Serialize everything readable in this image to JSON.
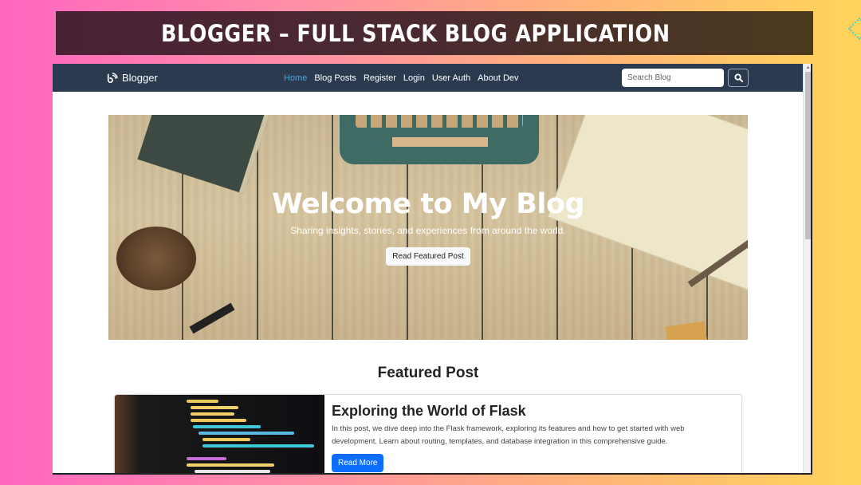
{
  "banner": {
    "title": "BLOGGER – FULL STACK BLOG APPLICATION"
  },
  "navbar": {
    "brand": "Blogger",
    "brand_icon": "feed-icon",
    "links": [
      {
        "label": "Home",
        "active": true
      },
      {
        "label": "Blog Posts",
        "active": false
      },
      {
        "label": "Register",
        "active": false
      },
      {
        "label": "Login",
        "active": false
      },
      {
        "label": "User Auth",
        "active": false
      },
      {
        "label": "About Dev",
        "active": false
      }
    ],
    "search": {
      "placeholder": "Search Blog",
      "value": "",
      "button_icon": "search-icon"
    }
  },
  "hero": {
    "title": "Welcome to My Blog",
    "subtitle": "Sharing insights, stories, and experiences from around the world.",
    "button_label": "Read Featured Post"
  },
  "featured": {
    "heading": "Featured Post",
    "post": {
      "title": "Exploring the World of Flask",
      "excerpt": "In this post, we dive deep into the Flask framework, exploring its features and how to get started with web development. Learn about routing, templates, and database integration in this comprehensive guide.",
      "button_label": "Read More"
    }
  },
  "colors": {
    "navbar_bg": "#2b3a4e",
    "active_link": "#4fa3d8",
    "primary_button": "#0d6efd",
    "banner_bg": "#4a2a30"
  }
}
